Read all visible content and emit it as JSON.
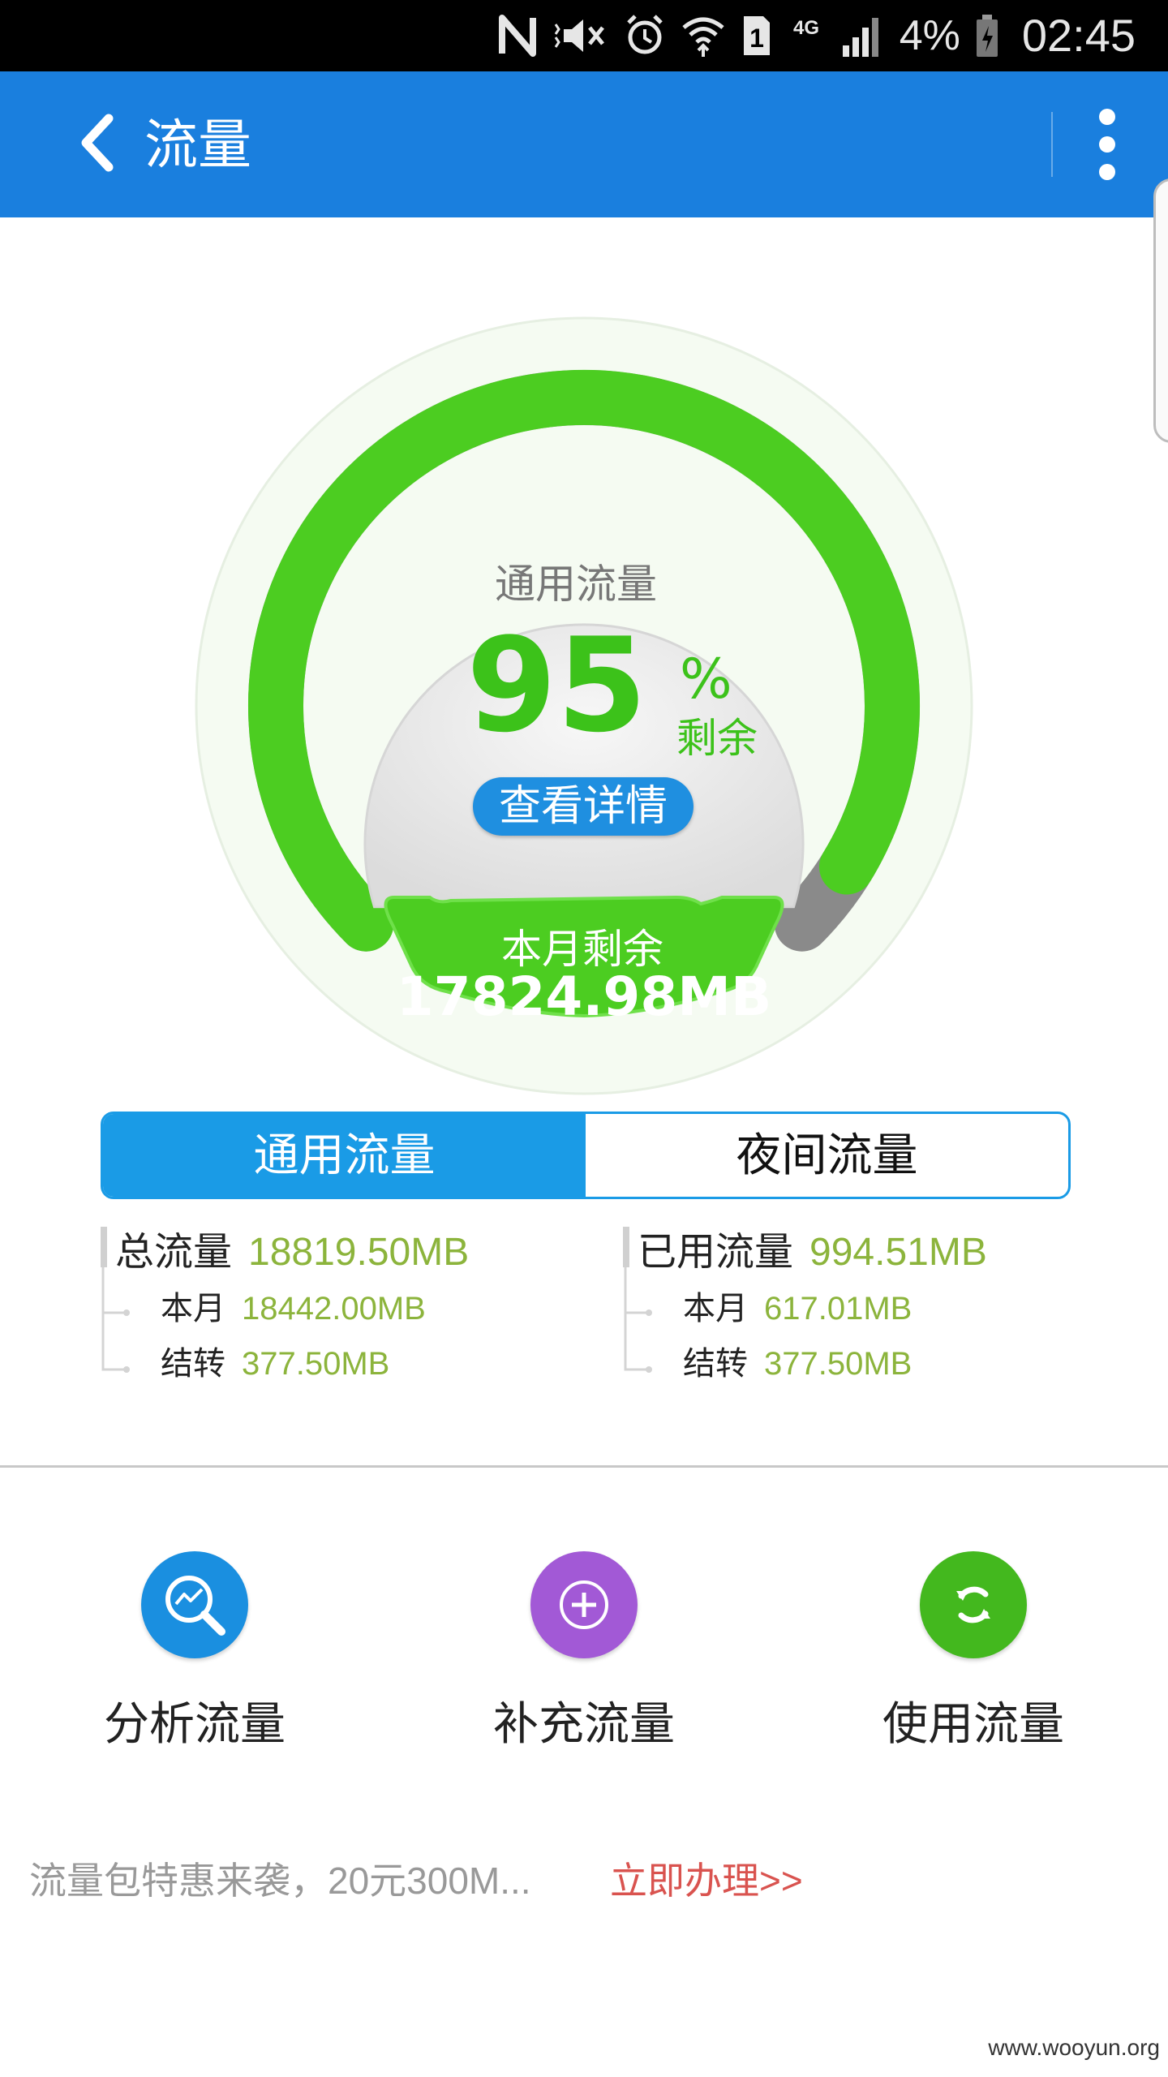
{
  "status_bar": {
    "battery": "4%",
    "time": "02:45",
    "sim": "1",
    "network": "4G",
    "icons": [
      "nfc-icon",
      "mute-icon",
      "alarm-icon",
      "wifi-icon",
      "sim-icon",
      "signal-icon",
      "battery-icon"
    ]
  },
  "appbar": {
    "title": "流量",
    "back_icon": "chevron-left-icon",
    "menu_icon": "more-vertical-icon"
  },
  "gauge": {
    "title": "通用流量",
    "percent_remaining": "95",
    "percent_sign": "%",
    "remaining_label": "剩余",
    "details_button": "查看详情",
    "monthly_label": "本月剩余",
    "monthly_value": "17824.98MB",
    "fill_fraction": 0.95,
    "colors": {
      "green": "#4ccd21",
      "gray": "#8a8a8a",
      "button_blue": "#1f8fe0"
    }
  },
  "tabs": [
    {
      "label": "通用流量",
      "active": true
    },
    {
      "label": "夜间流量",
      "active": false
    }
  ],
  "stats": {
    "total": {
      "label": "总流量",
      "value": "18819.50MB",
      "month_label": "本月",
      "month_value": "18442.00MB",
      "carry_label": "结转",
      "carry_value": "377.50MB"
    },
    "used": {
      "label": "已用流量",
      "value": "994.51MB",
      "month_label": "本月",
      "month_value": "617.01MB",
      "carry_label": "结转",
      "carry_value": "377.50MB"
    }
  },
  "actions": [
    {
      "label": "分析流量",
      "icon": "analytics-search-icon",
      "color": "#1a8fe0"
    },
    {
      "label": "补充流量",
      "icon": "plus-circle-icon",
      "color": "#a259d6"
    },
    {
      "label": "使用流量",
      "icon": "refresh-icon",
      "color": "#43b81e"
    }
  ],
  "promo": {
    "text": "流量包特惠来袭，20元300M...",
    "link": "立即办理>>"
  },
  "watermark": "www.wooyun.org"
}
